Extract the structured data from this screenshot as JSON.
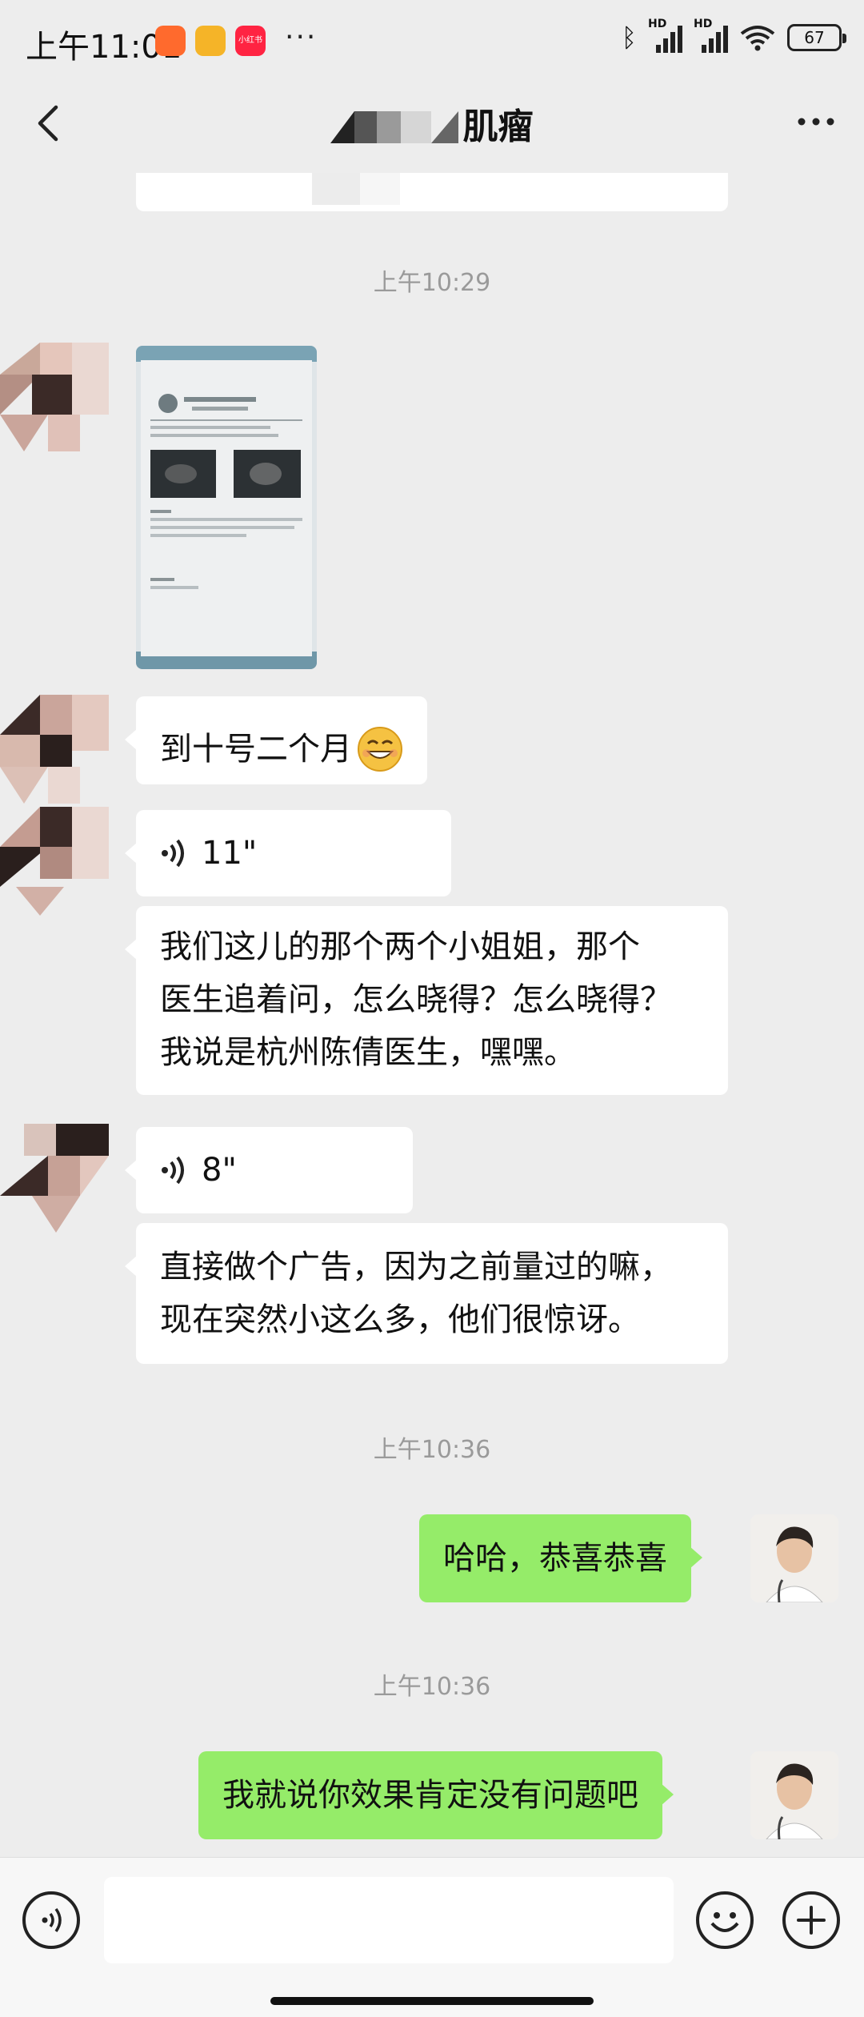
{
  "status_bar": {
    "time": "上午11:01",
    "apps": [
      "kuaishou-icon",
      "notes-icon",
      "xiaohongshu-icon"
    ],
    "app_label_red": "小红书",
    "more": "···",
    "battery": "67",
    "hd": "HD"
  },
  "header": {
    "title_suffix": "肌瘤"
  },
  "messages": {
    "ts1": "上午10:29",
    "ts2": "上午10:36",
    "ts3": "上午10:36",
    "m1": "到十号二个月",
    "voice1": "11\"",
    "m2_lines": [
      "我们这儿的那个两个小姐姐，那个",
      "医生追着问，怎么晓得？怎么晓得？",
      "我说是杭州陈倩医生，嘿嘿。"
    ],
    "voice2": "8\"",
    "m3_lines": [
      "直接做个广告，因为之前量过的嘛，",
      "现在突然小这么多，他们很惊讶。"
    ],
    "sent1": "哈哈，恭喜恭喜",
    "sent2": "我就说你效果肯定没有问题吧"
  },
  "colors": {
    "background": "#ededed",
    "sent_bubble": "#95ec69",
    "received_bubble": "#ffffff",
    "timestamp": "#9a9a9a"
  }
}
